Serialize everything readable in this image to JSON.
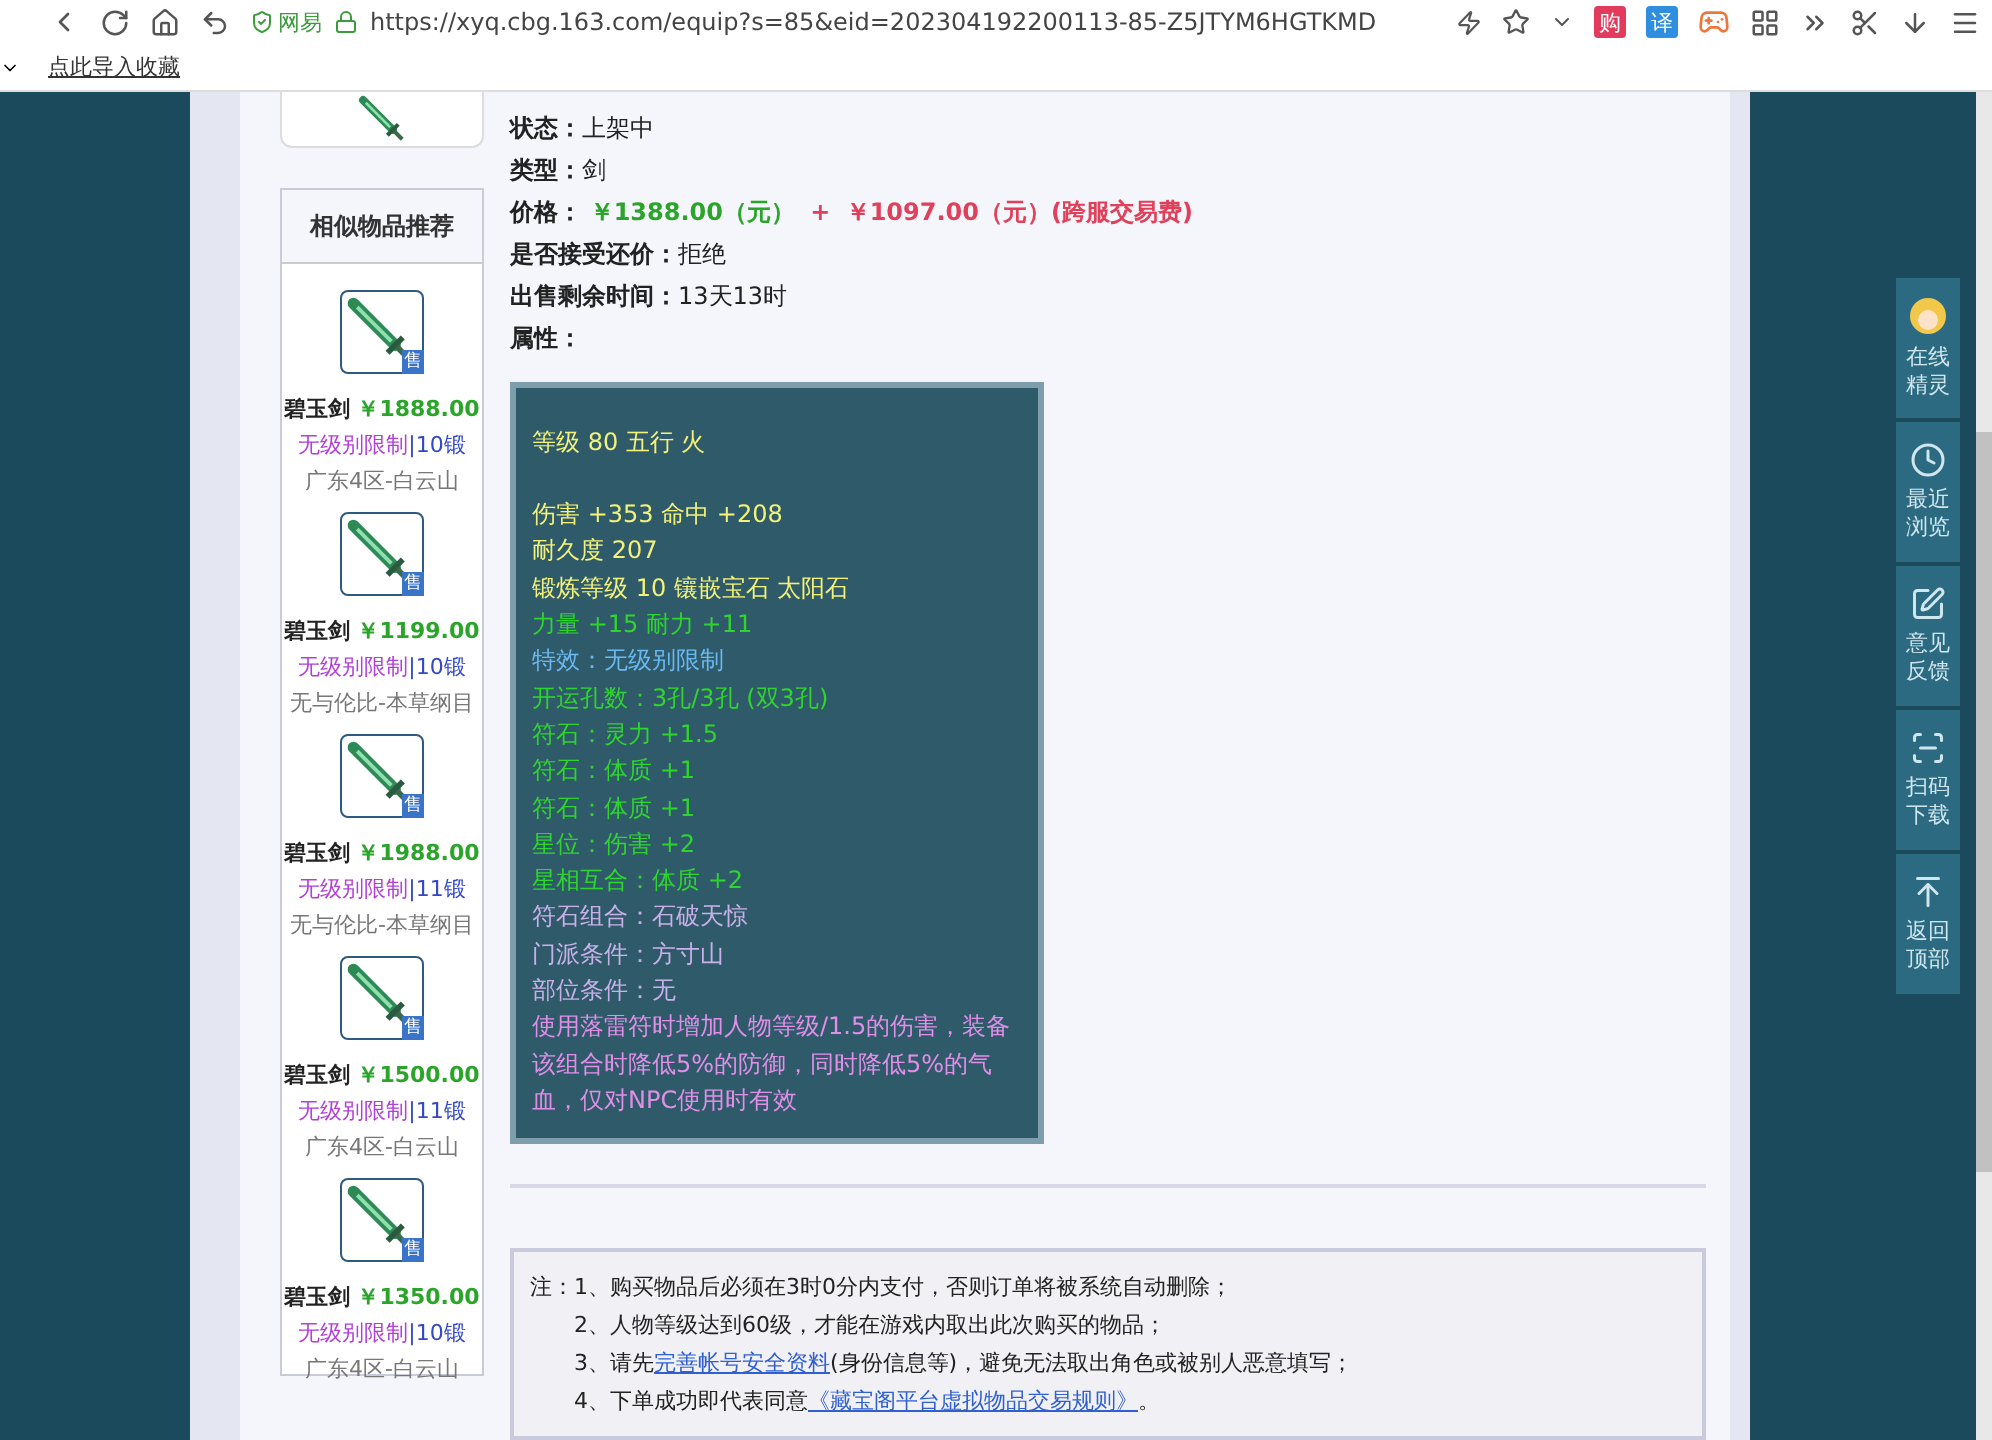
{
  "browser": {
    "site_badge": "网易",
    "url": "https://xyq.cbg.163.com/equip?s=85&eid=202304192200113-85-Z5JTYM6HGTKMD",
    "extensions": [
      {
        "label": "购",
        "color": "#e23b5e"
      },
      {
        "label": "译",
        "color": "#2f8ee0"
      }
    ],
    "bookmarks": [
      {
        "label": "点此导入收藏"
      }
    ]
  },
  "details": [
    {
      "label": "状态：",
      "value": "上架中"
    },
    {
      "label": "类型：",
      "value": "剑"
    }
  ],
  "price": {
    "label": "价格：",
    "base": "￥1388.00（元）",
    "plus": "+",
    "fee": "￥1097.00（元）(跨服交易费)"
  },
  "details_after": [
    {
      "label": "是否接受还价：",
      "value": "拒绝"
    },
    {
      "label": "出售剩余时间：",
      "value": "13天13时"
    },
    {
      "label": "属性："
    }
  ],
  "attributes": [
    [
      {
        "text": "等级 80 五行 火",
        "color": "#f2f27a"
      }
    ],
    [
      {
        "text": "伤害 +353 命中 +208",
        "color": "#f2f27a"
      },
      {
        "text": "耐久度 207",
        "color": "#f2f27a"
      },
      {
        "text": "锻炼等级 10 镶嵌宝石 太阳石",
        "color": "#f2f27a"
      },
      {
        "text": "力量 +15 耐力 +11",
        "color": "#2fd42f"
      },
      {
        "text": "特效：无级别限制",
        "color": "#6ab8f0"
      },
      {
        "text": "开运孔数：3孔/3孔 (双3孔)",
        "color": "#2fd42f"
      },
      {
        "text": "符石：灵力 +1.5",
        "color": "#2fd42f"
      },
      {
        "text": "符石：体质 +1",
        "color": "#2fd42f"
      },
      {
        "text": "符石：体质 +1",
        "color": "#2fd42f"
      },
      {
        "text": "星位：伤害 +2",
        "color": "#2fd42f"
      },
      {
        "text": "星相互合：体质 +2",
        "color": "#2fd42f"
      },
      {
        "text": "符石组合：石破天惊",
        "color": "#c8b0e8"
      },
      {
        "text": "门派条件：方寸山",
        "color": "#c8b0e8"
      },
      {
        "text": "部位条件：无",
        "color": "#c8b0e8"
      },
      {
        "text": "使用落雷符时增加人物等级/1.5的伤害，装备该组合时降低5%的防御，同时降低5%的气血，仅对NPC使用时有效",
        "color": "#e08ee8"
      }
    ]
  ],
  "similar": {
    "title": "相似物品推荐",
    "items": [
      {
        "badge": "售",
        "name": "碧玉剑",
        "price": "￥1888.00",
        "restriction": "无级别限制",
        "forge": "|10锻",
        "server": "广东4区-白云山"
      },
      {
        "badge": "售",
        "name": "碧玉剑",
        "price": "￥1199.00",
        "restriction": "无级别限制",
        "forge": "|10锻",
        "server": "无与伦比-本草纲目"
      },
      {
        "badge": "售",
        "name": "碧玉剑",
        "price": "￥1988.00",
        "restriction": "无级别限制",
        "forge": "|11锻",
        "server": "无与伦比-本草纲目"
      },
      {
        "badge": "售",
        "name": "碧玉剑",
        "price": "￥1500.00",
        "restriction": "无级别限制",
        "forge": "|11锻",
        "server": "广东4区-白云山"
      },
      {
        "badge": "售",
        "name": "碧玉剑",
        "price": "￥1350.00",
        "restriction": "无级别限制",
        "forge": "|10锻",
        "server": "广东4区-白云山"
      }
    ]
  },
  "notes": {
    "prefix": "注：",
    "items": [
      {
        "before": "1、购买物品后必须在3时0分内支付，否则订单将被系统自动删除；"
      },
      {
        "before": "2、人物等级达到60级，才能在游戏内取出此次购买的物品；"
      },
      {
        "before": "3、请先",
        "link": "完善帐号安全资料",
        "after": "(身份信息等)，避免无法取出角色或被别人恶意填写；"
      },
      {
        "before": "4、下单成功即代表同意",
        "link": "《藏宝阁平台虚拟物品交易规则》",
        "after": "。"
      }
    ]
  },
  "float_bar": [
    {
      "kind": "avatar",
      "label": "在线精灵"
    },
    {
      "kind": "clock",
      "label": "最近浏览"
    },
    {
      "kind": "edit",
      "label": "意见反馈"
    },
    {
      "kind": "scan",
      "label": "扫码下载"
    },
    {
      "kind": "top",
      "label": "返回顶部"
    }
  ]
}
